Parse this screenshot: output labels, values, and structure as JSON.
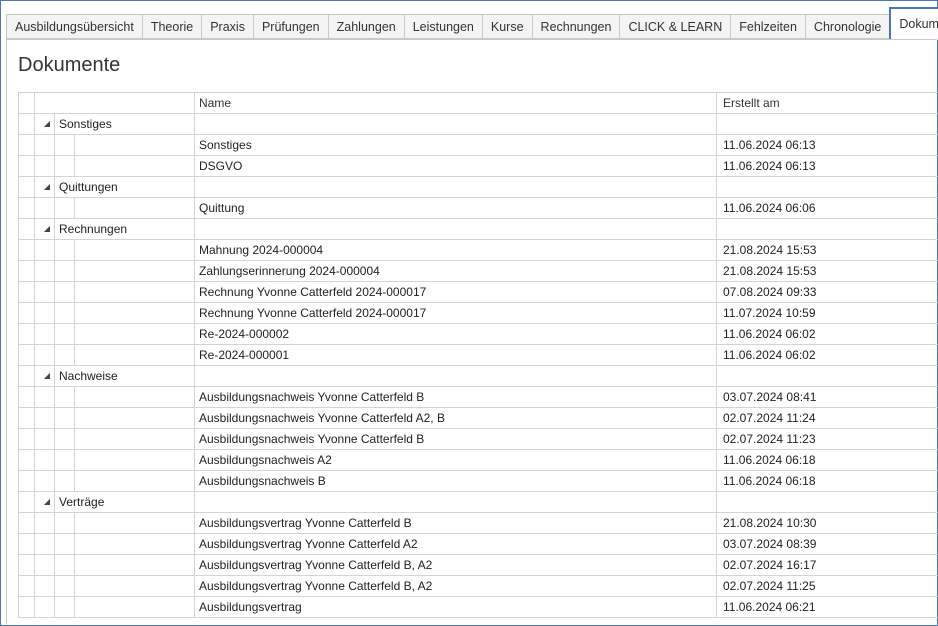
{
  "tabs": [
    {
      "label": "Ausbildungsübersicht",
      "active": false
    },
    {
      "label": "Theorie",
      "active": false
    },
    {
      "label": "Praxis",
      "active": false
    },
    {
      "label": "Prüfungen",
      "active": false
    },
    {
      "label": "Zahlungen",
      "active": false
    },
    {
      "label": "Leistungen",
      "active": false
    },
    {
      "label": "Kurse",
      "active": false
    },
    {
      "label": "Rechnungen",
      "active": false
    },
    {
      "label": "CLICK & LEARN",
      "active": false
    },
    {
      "label": "Fehlzeiten",
      "active": false
    },
    {
      "label": "Chronologie",
      "active": false
    },
    {
      "label": "Dokumente",
      "active": true
    }
  ],
  "page_title": "Dokumente",
  "grid": {
    "columns": {
      "name": "Name",
      "created": "Erstellt am"
    },
    "expander_glyph": "◢",
    "groups": [
      {
        "label": "Sonstiges",
        "rows": [
          {
            "name": "Sonstiges",
            "created": "11.06.2024 06:13"
          },
          {
            "name": "DSGVO",
            "created": "11.06.2024 06:13"
          }
        ]
      },
      {
        "label": "Quittungen",
        "rows": [
          {
            "name": "Quittung",
            "created": "11.06.2024 06:06"
          }
        ]
      },
      {
        "label": "Rechnungen",
        "rows": [
          {
            "name": "Mahnung 2024-000004",
            "created": "21.08.2024 15:53"
          },
          {
            "name": "Zahlungserinnerung 2024-000004",
            "created": "21.08.2024 15:53"
          },
          {
            "name": "Rechnung Yvonne Catterfeld 2024-000017",
            "created": "07.08.2024 09:33"
          },
          {
            "name": "Rechnung Yvonne Catterfeld 2024-000017",
            "created": "11.07.2024 10:59"
          },
          {
            "name": "Re-2024-000002",
            "created": "11.06.2024 06:02"
          },
          {
            "name": "Re-2024-000001",
            "created": "11.06.2024 06:02"
          }
        ]
      },
      {
        "label": "Nachweise",
        "rows": [
          {
            "name": "Ausbildungsnachweis Yvonne Catterfeld B",
            "created": "03.07.2024 08:41"
          },
          {
            "name": "Ausbildungsnachweis Yvonne Catterfeld A2, B",
            "created": "02.07.2024 11:24"
          },
          {
            "name": "Ausbildungsnachweis Yvonne Catterfeld B",
            "created": "02.07.2024 11:23"
          },
          {
            "name": "Ausbildungsnachweis A2",
            "created": "11.06.2024 06:18"
          },
          {
            "name": "Ausbildungsnachweis B",
            "created": "11.06.2024 06:18"
          }
        ]
      },
      {
        "label": "Verträge",
        "rows": [
          {
            "name": "Ausbildungsvertrag Yvonne Catterfeld B",
            "created": "21.08.2024 10:30"
          },
          {
            "name": "Ausbildungsvertrag Yvonne Catterfeld A2",
            "created": "03.07.2024 08:39"
          },
          {
            "name": "Ausbildungsvertrag Yvonne Catterfeld B, A2",
            "created": "02.07.2024 16:17"
          },
          {
            "name": "Ausbildungsvertrag Yvonne Catterfeld B, A2",
            "created": "02.07.2024 11:25"
          },
          {
            "name": "Ausbildungsvertrag",
            "created": "11.06.2024 06:21"
          }
        ]
      }
    ]
  }
}
